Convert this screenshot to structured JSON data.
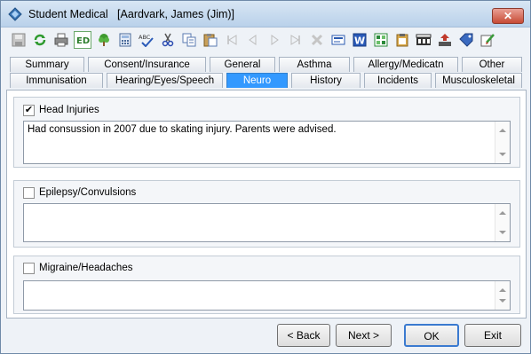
{
  "window": {
    "title": "Student Medical   [Aardvark, James (Jim)]",
    "close_label": "✕"
  },
  "toolbar": {
    "buttons": [
      {
        "name": "save-icon"
      },
      {
        "name": "refresh-icon"
      },
      {
        "name": "print-icon"
      },
      {
        "name": "ed-icon"
      },
      {
        "name": "tree-icon"
      },
      {
        "name": "calculator-icon"
      },
      {
        "name": "spellcheck-icon"
      },
      {
        "name": "cut-icon"
      },
      {
        "name": "copy-icon"
      },
      {
        "name": "paste-icon"
      },
      {
        "name": "first-record-icon"
      },
      {
        "name": "prev-record-icon"
      },
      {
        "name": "next-record-icon"
      },
      {
        "name": "last-record-icon"
      },
      {
        "name": "delete-icon"
      },
      {
        "name": "card-icon"
      },
      {
        "name": "word-icon"
      },
      {
        "name": "excel-icon"
      },
      {
        "name": "clipboard-icon"
      },
      {
        "name": "film-icon"
      },
      {
        "name": "upload-icon"
      },
      {
        "name": "tag-icon"
      },
      {
        "name": "edit-doc-icon"
      }
    ]
  },
  "tabs": {
    "row1": [
      "Summary",
      "Consent/Insurance",
      "General",
      "Asthma",
      "Allergy/Medicatn",
      "Other"
    ],
    "row2": [
      "Immunisation",
      "Hearing/Eyes/Speech",
      "Neuro",
      "History",
      "Incidents",
      "Musculoskeletal"
    ],
    "active": "Neuro"
  },
  "sections": {
    "head_injuries": {
      "label": "Head Injuries",
      "checked": "✔",
      "text": "Had consussion in 2007 due to skating injury. Parents were advised."
    },
    "epilepsy": {
      "label": "Epilepsy/Convulsions",
      "checked": "",
      "text": ""
    },
    "migraine": {
      "label": "Migraine/Headaches",
      "checked": "",
      "text": ""
    }
  },
  "buttons": {
    "back": "Back",
    "next": "Next >",
    "ok": "OK",
    "exit": "Exit"
  },
  "colors": {
    "active_tab": "#3399ff",
    "window_bg": "#eef2f7"
  }
}
